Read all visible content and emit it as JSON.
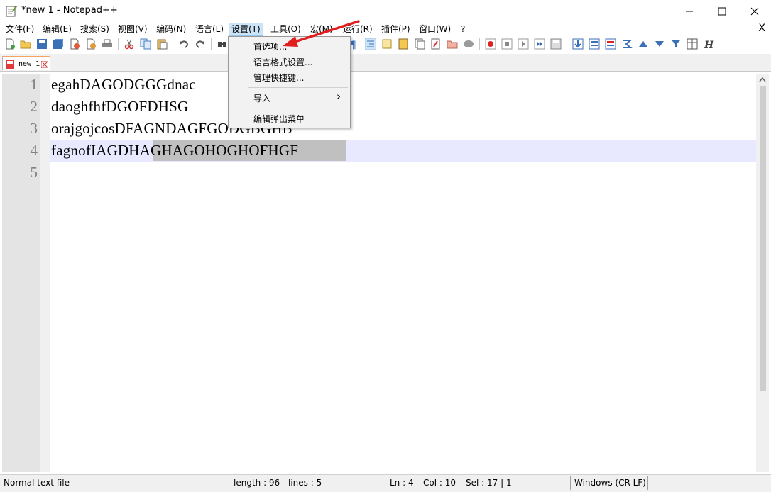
{
  "window": {
    "title": "*new 1 - Notepad++",
    "controls": {
      "minimize": "—",
      "maximize": "☐",
      "close": "✕"
    }
  },
  "menubar": {
    "items": [
      {
        "label": "文件(F)"
      },
      {
        "label": "编辑(E)"
      },
      {
        "label": "搜索(S)"
      },
      {
        "label": "视图(V)"
      },
      {
        "label": "编码(N)"
      },
      {
        "label": "语言(L)"
      },
      {
        "label": "设置(T)",
        "active": true
      },
      {
        "label": "工具(O)"
      },
      {
        "label": "宏(M)"
      },
      {
        "label": "运行(R)"
      },
      {
        "label": "插件(P)"
      },
      {
        "label": "窗口(W)"
      },
      {
        "label": "?"
      }
    ],
    "close_doc": "X"
  },
  "dropdown": {
    "items": [
      {
        "label": "首选项..."
      },
      {
        "label": "语言格式设置..."
      },
      {
        "label": "管理快捷键..."
      },
      {
        "label": "导入",
        "submenu_arrow": "›"
      },
      {
        "label": "编辑弹出菜单"
      }
    ]
  },
  "tab": {
    "label": "new 1"
  },
  "editor": {
    "line_numbers": [
      "1",
      "2",
      "3",
      "4",
      "5"
    ],
    "lines": [
      "egahDAGODGGGdnac",
      "daoghfhfDGOFDHSG",
      "orajgojcosDFAGNDAGFGODGBGHB",
      "fagnofIAGDHAGHAGOHOGHOFHGF",
      ""
    ]
  },
  "statusbar": {
    "file_type": "Normal text file",
    "length": "length : 96",
    "lines": "lines : 5",
    "ln": "Ln : 4",
    "col": "Col : 10",
    "sel": "Sel : 17 | 1",
    "eol": "Windows (CR LF)"
  },
  "colors": {
    "menu_active_bg": "#cce4f7",
    "caret_line_bg": "#e8e8ff",
    "selection_bg": "#c0c0c0",
    "annotation_arrow": "#e0201f"
  }
}
